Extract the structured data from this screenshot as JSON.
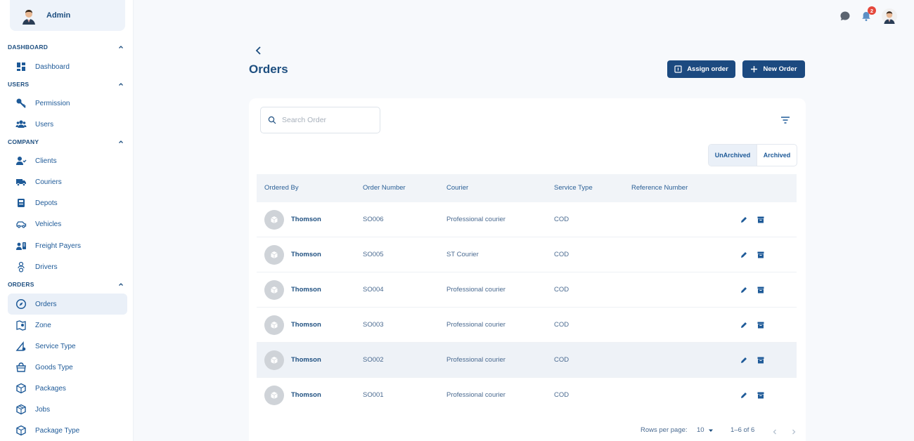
{
  "user": {
    "name": "Admin"
  },
  "colors": {
    "primary": "#1c4a80",
    "accent": "#1e5a98",
    "badge": "#e5483c",
    "active_bg": "#eaf0f8"
  },
  "sections": {
    "dashboard": "DASHBOARD",
    "users": "USERS",
    "company": "COMPANY",
    "orders": "ORDERS"
  },
  "nav": {
    "dashboard": {
      "label": "Dashboard",
      "icon": "dashboard-icon"
    },
    "permission": {
      "label": "Permission",
      "icon": "key-icon"
    },
    "users": {
      "label": "Users",
      "icon": "users-icon"
    },
    "clients": {
      "label": "Clients",
      "icon": "clients-icon"
    },
    "couriers": {
      "label": "Couriers",
      "icon": "truck-icon"
    },
    "depots": {
      "label": "Depots",
      "icon": "depot-icon"
    },
    "vehicles": {
      "label": "Vehicles",
      "icon": "car-icon"
    },
    "freight_payers": {
      "label": "Freight Payers",
      "icon": "contact-card-icon"
    },
    "drivers": {
      "label": "Drivers",
      "icon": "driver-icon"
    },
    "orders": {
      "label": "Orders",
      "icon": "compass-icon"
    },
    "zone": {
      "label": "Zone",
      "icon": "map-zone-icon"
    },
    "service_type": {
      "label": "Service Type",
      "icon": "service-icon"
    },
    "goods_type": {
      "label": "Goods Type",
      "icon": "bag-icon"
    },
    "packages": {
      "label": "Packages",
      "icon": "package-icon"
    },
    "jobs": {
      "label": "Jobs",
      "icon": "box-icon"
    },
    "package_type": {
      "label": "Package Type",
      "icon": "cube-icon"
    }
  },
  "topbar": {
    "notification_count": "2"
  },
  "page": {
    "title": "Orders",
    "assign_label": "Assign order",
    "new_label": "New Order"
  },
  "search": {
    "placeholder": "Search Order"
  },
  "tabs": {
    "unarchived": "UnArchived",
    "archived": "Archived"
  },
  "table": {
    "columns": [
      "Ordered By",
      "Order Number",
      "Courier",
      "Service Type",
      "Reference Number"
    ],
    "rows": [
      {
        "ordered_by": "Thomson",
        "order_number": "SO006",
        "courier": "Professional courier",
        "service_type": "COD",
        "reference": ""
      },
      {
        "ordered_by": "Thomson",
        "order_number": "SO005",
        "courier": "ST Courier",
        "service_type": "COD",
        "reference": ""
      },
      {
        "ordered_by": "Thomson",
        "order_number": "SO004",
        "courier": "Professional courier",
        "service_type": "COD",
        "reference": ""
      },
      {
        "ordered_by": "Thomson",
        "order_number": "SO003",
        "courier": "Professional courier",
        "service_type": "COD",
        "reference": ""
      },
      {
        "ordered_by": "Thomson",
        "order_number": "SO002",
        "courier": "Professional courier",
        "service_type": "COD",
        "reference": ""
      },
      {
        "ordered_by": "Thomson",
        "order_number": "SO001",
        "courier": "Professional courier",
        "service_type": "COD",
        "reference": ""
      }
    ]
  },
  "pagination": {
    "rows_label": "Rows per page:",
    "rows_value": "10",
    "range": "1–6 of 6"
  }
}
